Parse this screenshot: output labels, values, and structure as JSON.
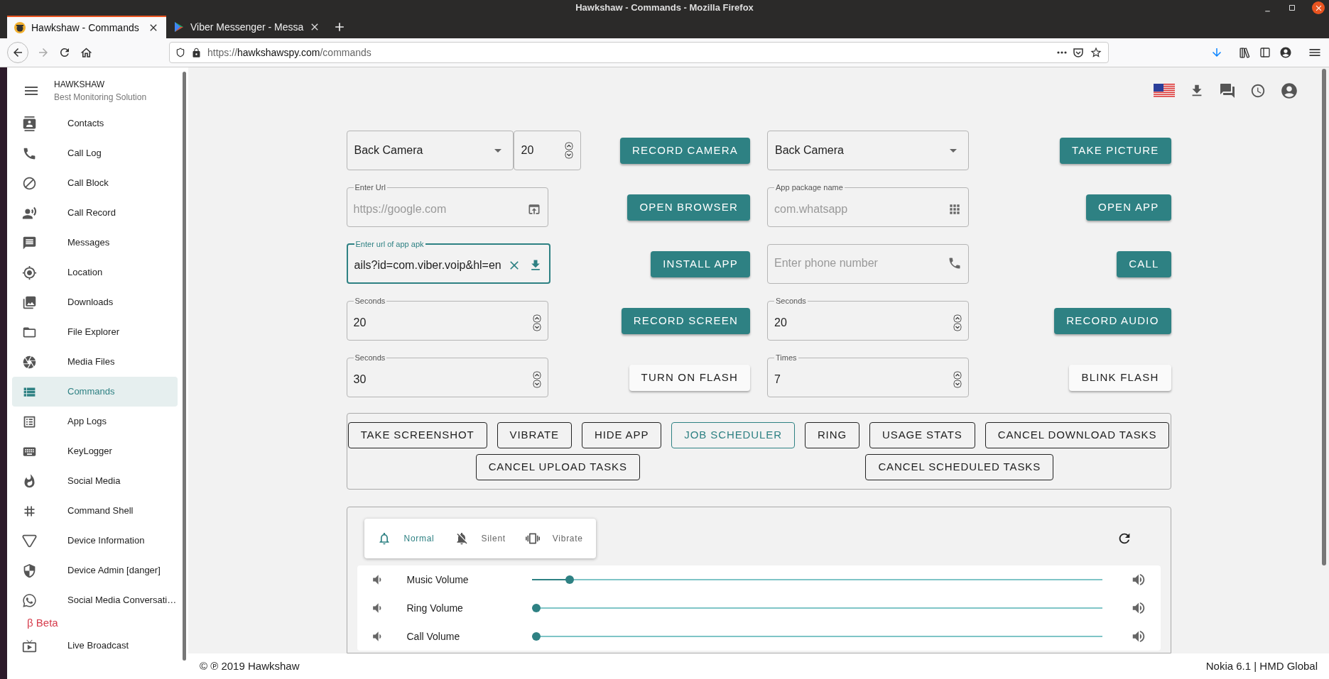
{
  "window": {
    "title": "Hawkshaw - Commands - Mozilla Firefox"
  },
  "tabs": [
    {
      "title": "Hawkshaw - Commands",
      "selected": true
    },
    {
      "title": "Viber Messenger - Messa",
      "selected": false
    }
  ],
  "address_bar": {
    "scheme": "https://",
    "domain": "hawkshawspy.com",
    "path": "/commands"
  },
  "sidebar": {
    "brand": "HAWKSHAW",
    "tagline": "Best Monitoring Solution",
    "items": [
      {
        "label": "Contacts",
        "selected": false
      },
      {
        "label": "Call Log",
        "selected": false
      },
      {
        "label": "Call Block",
        "selected": false
      },
      {
        "label": "Call Record",
        "selected": false
      },
      {
        "label": "Messages",
        "selected": false
      },
      {
        "label": "Location",
        "selected": false
      },
      {
        "label": "Downloads",
        "selected": false
      },
      {
        "label": "File Explorer",
        "selected": false
      },
      {
        "label": "Media Files",
        "selected": false
      },
      {
        "label": "Commands",
        "selected": true
      },
      {
        "label": "App Logs",
        "selected": false
      },
      {
        "label": "KeyLogger",
        "selected": false
      },
      {
        "label": "Social Media",
        "selected": false
      },
      {
        "label": "Command Shell",
        "selected": false
      },
      {
        "label": "Device Information",
        "selected": false
      },
      {
        "label": "Device Admin [danger]",
        "selected": false
      },
      {
        "label": "Social Media Conversati…",
        "selected": false
      }
    ],
    "section_label": "β Beta",
    "beta_items": [
      {
        "label": "Live Broadcast",
        "selected": false
      }
    ]
  },
  "commands": [
    {
      "field": {
        "kind": "select",
        "value": "Back Camera",
        "number": "20"
      },
      "button": {
        "label": "RECORD CAMERA",
        "kind": "filled"
      }
    },
    {
      "field": {
        "kind": "select",
        "value": "Back Camera"
      },
      "button": {
        "label": "TAKE PICTURE",
        "kind": "filled"
      }
    },
    {
      "field": {
        "kind": "url",
        "label": "Enter Url",
        "placeholder": "https://google.com"
      },
      "button": {
        "label": "OPEN BROWSER",
        "kind": "filled"
      }
    },
    {
      "field": {
        "kind": "package",
        "label": "App package name",
        "placeholder": "com.whatsapp"
      },
      "button": {
        "label": "OPEN APP",
        "kind": "filled"
      }
    },
    {
      "field": {
        "kind": "apk",
        "label": "Enter url of app apk",
        "value": "ails?id=com.viber.voip&hl=en",
        "focused": true
      },
      "button": {
        "label": "INSTALL APP",
        "kind": "filled"
      }
    },
    {
      "field": {
        "kind": "phone",
        "placeholder": "Enter phone number"
      },
      "button": {
        "label": "CALL",
        "kind": "filled"
      }
    },
    {
      "field": {
        "kind": "number",
        "label": "Seconds",
        "value": "20"
      },
      "button": {
        "label": "RECORD SCREEN",
        "kind": "filled"
      }
    },
    {
      "field": {
        "kind": "number",
        "label": "Seconds",
        "value": "20"
      },
      "button": {
        "label": "RECORD AUDIO",
        "kind": "filled"
      }
    },
    {
      "field": {
        "kind": "number",
        "label": "Seconds",
        "value": "30"
      },
      "button": {
        "label": "TURN ON FLASH",
        "kind": "light"
      }
    },
    {
      "field": {
        "kind": "number",
        "label": "Times",
        "value": "7"
      },
      "button": {
        "label": "BLINK FLASH",
        "kind": "light"
      }
    }
  ],
  "quick_action_rows": [
    {
      "buttons": [
        {
          "label": "TAKE SCREENSHOT",
          "selected": false
        },
        {
          "label": "VIBRATE",
          "selected": false
        },
        {
          "label": "HIDE APP",
          "selected": false
        },
        {
          "label": "JOB SCHEDULER",
          "selected": true
        },
        {
          "label": "RING",
          "selected": false
        },
        {
          "label": "USAGE STATS",
          "selected": false
        },
        {
          "label": "CANCEL DOWNLOAD TASKS",
          "selected": false
        }
      ]
    },
    {
      "buttons": [
        {
          "label": "CANCEL UPLOAD TASKS",
          "selected": false
        },
        {
          "label": "CANCEL SCHEDULED TASKS",
          "selected": false
        }
      ]
    }
  ],
  "sound_modes": [
    {
      "kind": "normal",
      "label": "Normal",
      "selected": true
    },
    {
      "kind": "silent",
      "label": "Silent",
      "selected": false
    },
    {
      "kind": "vibrate",
      "label": "Vibrate",
      "selected": false
    }
  ],
  "volumes": [
    {
      "label": "Music Volume",
      "level": 0.06
    },
    {
      "label": "Ring Volume",
      "level": 0
    },
    {
      "label": "Call Volume",
      "level": 0
    }
  ],
  "footer": {
    "copyright": "© ℗ 2019 Hawkshaw",
    "device": "Nokia 6.1 | HMD Global"
  }
}
